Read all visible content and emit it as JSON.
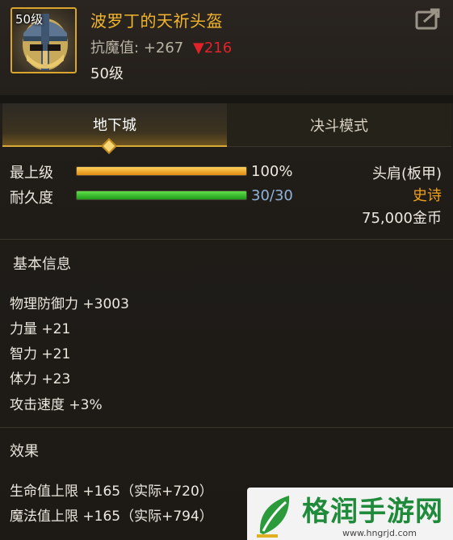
{
  "item": {
    "frame_level": "50级",
    "name": "波罗丁的天祈头盔",
    "stat_label": "抗魔值:",
    "stat_value": "+267",
    "stat_delta_arrow": "▼",
    "stat_delta": "216",
    "level": "50级"
  },
  "tabs": [
    {
      "label": "地下城",
      "active": true
    },
    {
      "label": "决斗模式",
      "active": false
    }
  ],
  "bars": {
    "level_label": "最上级",
    "level_value": "100%",
    "level_fraction": 1.0,
    "durability_label": "耐久度",
    "durability_value": "30/30",
    "durability_fraction": 1.0
  },
  "meta": {
    "slot": "头肩(板甲)",
    "rarity": "史诗",
    "price": "75,000金币"
  },
  "basic_info": {
    "title": "基本信息",
    "attrs": [
      "物理防御力 +3003",
      "力量 +21",
      "智力 +21",
      "体力 +23",
      "攻击速度 +3%"
    ]
  },
  "effects": {
    "title": "效果",
    "attrs": [
      "生命值上限 +165（实际+720）",
      "魔法值上限 +165（实际+794）"
    ]
  },
  "watermark": {
    "text": "格润手游网",
    "url": "www.hngrjd.com"
  },
  "colors": {
    "accent": "#f2b52c",
    "rarity": "#f2a01c",
    "delta": "#e2222b",
    "durability_text": "#8fb3d9"
  }
}
